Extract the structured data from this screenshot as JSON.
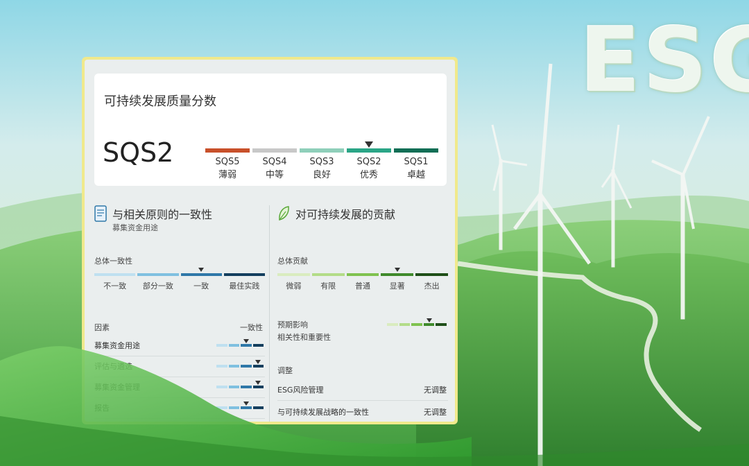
{
  "brand": {
    "logo_text": "ESG"
  },
  "score_card": {
    "title": "可持续发展质量分数",
    "score": "SQS2",
    "scale": [
      {
        "code": "SQS5",
        "label": "薄弱",
        "color": "#c8502a"
      },
      {
        "code": "SQS4",
        "label": "中等",
        "color": "#c8c8c8"
      },
      {
        "code": "SQS3",
        "label": "良好",
        "color": "#8fcfba"
      },
      {
        "code": "SQS2",
        "label": "优秀",
        "color": "#2aa586"
      },
      {
        "code": "SQS1",
        "label": "卓越",
        "color": "#0f6e55"
      }
    ],
    "selected_index": 3
  },
  "alignment": {
    "title": "与相关原则的一致性",
    "subtitle": "募集资金用途",
    "overall_label": "总体一致性",
    "scale": [
      {
        "label": "不一致",
        "color": "#bfe0f0"
      },
      {
        "label": "部分一致",
        "color": "#7fc0e0"
      },
      {
        "label": "一致",
        "color": "#2f78a8"
      },
      {
        "label": "最佳实践",
        "color": "#143f5e"
      }
    ],
    "selected_index": 2,
    "factor_header": "因素",
    "factor_value_header": "一致性",
    "factors": [
      {
        "label": "募集资金用途",
        "selected_index": 2
      },
      {
        "label": "评估与遴选",
        "selected_index": 3
      },
      {
        "label": "募集资金管理",
        "selected_index": 3
      },
      {
        "label": "报告",
        "selected_index": 2
      }
    ]
  },
  "contribution": {
    "title": "对可持续发展的贡献",
    "overall_label": "总体贡献",
    "scale": [
      {
        "label": "微弱",
        "color": "#d9ecbf"
      },
      {
        "label": "有限",
        "color": "#b3dc88"
      },
      {
        "label": "普通",
        "color": "#7fc24f"
      },
      {
        "label": "显著",
        "color": "#3f8a2b"
      },
      {
        "label": "杰出",
        "color": "#1f4f18"
      }
    ],
    "selected_index": 3,
    "impact_label": "预期影响",
    "impact_sub": "相关性和重要性",
    "impact_selected_index": 3,
    "adjust_header": "调整",
    "adjustments": [
      {
        "label": "ESG风险管理",
        "value": "无调整"
      },
      {
        "label": "与可持续发展战略的一致性",
        "value": "无调整"
      }
    ]
  }
}
